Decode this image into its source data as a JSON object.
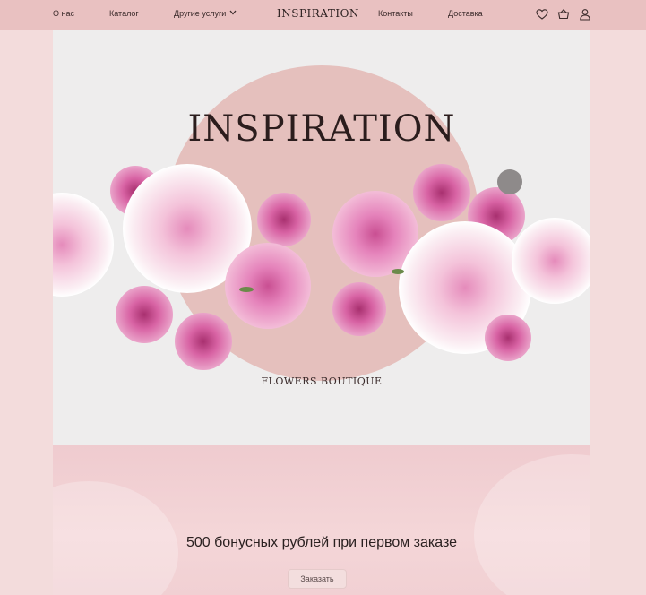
{
  "nav": {
    "about": "О нас",
    "catalog": "Каталог",
    "services": "Другие услуги",
    "logo": "INSPIRATION",
    "contacts": "Контакты",
    "delivery": "Доставка",
    "icons": [
      "heart-icon",
      "basket-icon",
      "user-icon"
    ]
  },
  "hero": {
    "title": "INSPIRATION",
    "subtitle": "FLOWERS BOUTIQUE"
  },
  "banner": {
    "text": "500 бонусных рублей при первом заказе",
    "button": "Заказать"
  },
  "colors": {
    "header_bg": "#e9c1c1",
    "page_bg": "#f3dcdc",
    "hero_bg": "#eeeded",
    "circle": "#e5c0bd",
    "peony_pink": "#e07fb4",
    "peony_light": "#f6cfe0"
  }
}
